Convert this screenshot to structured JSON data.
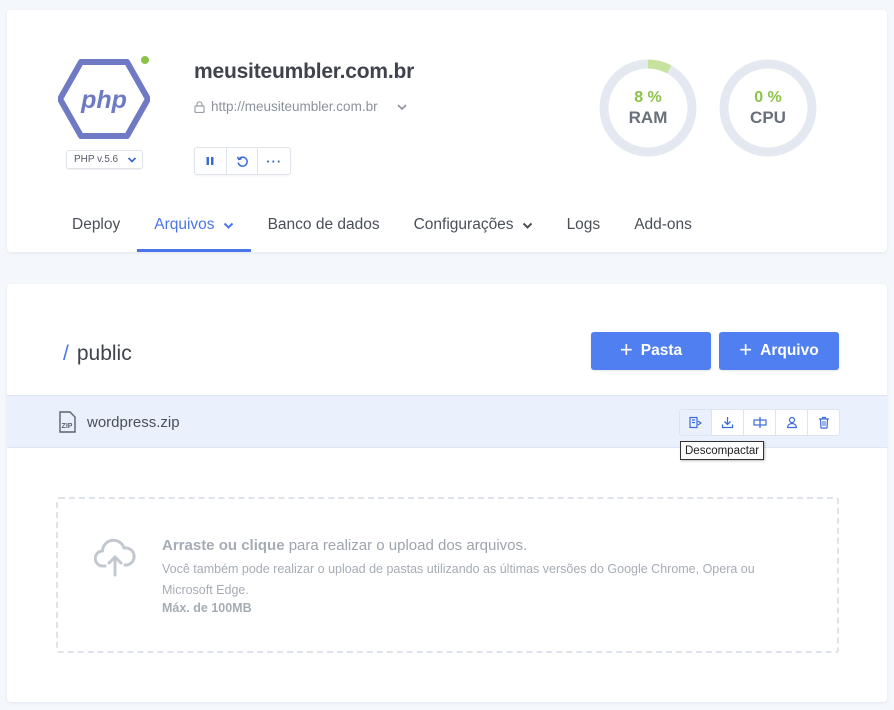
{
  "site": {
    "title": "meusiteumbler.com.br",
    "url": "http://meusiteumbler.com.br",
    "php_logo_text": "php",
    "php_version": "PHP v.5.6",
    "status_color": "#8bc34a"
  },
  "controls": {
    "pause_icon": "pause-icon",
    "restart_icon": "restart-icon",
    "more_label": "···"
  },
  "gauges": {
    "ram": {
      "value": "8 %",
      "percent": 8,
      "label": "RAM"
    },
    "cpu": {
      "value": "0 %",
      "percent": 0,
      "label": "CPU"
    }
  },
  "tabs": [
    {
      "label": "Deploy",
      "active": false,
      "dropdown": false
    },
    {
      "label": "Arquivos",
      "active": true,
      "dropdown": true
    },
    {
      "label": "Banco de dados",
      "active": false,
      "dropdown": false
    },
    {
      "label": "Configurações",
      "active": false,
      "dropdown": true
    },
    {
      "label": "Logs",
      "active": false,
      "dropdown": false
    },
    {
      "label": "Add-ons",
      "active": false,
      "dropdown": false
    }
  ],
  "files": {
    "path_separator": "/",
    "current_path": "public",
    "new_folder_label": "Pasta",
    "new_file_label": "Arquivo",
    "items": [
      {
        "name": "wordpress.zip",
        "icon": "zip-file-icon",
        "icon_text": "ZIP"
      }
    ],
    "tooltip": "Descompactar"
  },
  "dropzone": {
    "title_bold": "Arraste ou clique",
    "title_rest": " para realizar o upload dos arquivos.",
    "subtitle": "Você também pode realizar o upload de pastas utilizando as últimas versões do Google Chrome, Opera ou Microsoft Edge.",
    "max_size": "Máx. de 100MB"
  },
  "colors": {
    "accent": "#4a76e8",
    "button": "#4f7ff0",
    "gauge_fill": "#8bc34a",
    "gauge_track": "#e3e8f1"
  }
}
